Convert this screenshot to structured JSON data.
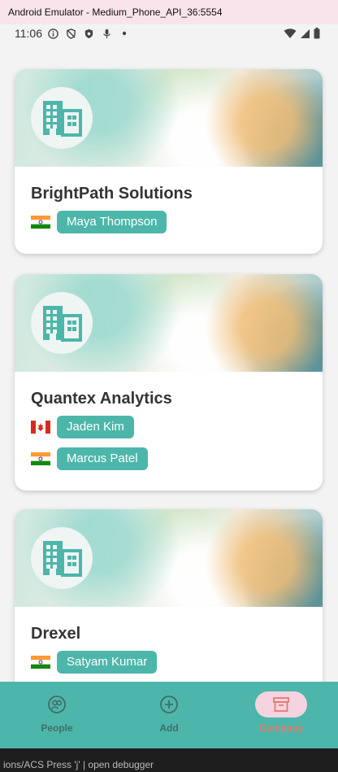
{
  "window": {
    "title": "Android Emulator - Medium_Phone_API_36:5554"
  },
  "statusbar": {
    "time": "11:06"
  },
  "companies": [
    {
      "name": "BrightPath Solutions",
      "people": [
        {
          "flag": "india",
          "name": "Maya Thompson"
        }
      ]
    },
    {
      "name": "Quantex Analytics",
      "people": [
        {
          "flag": "canada",
          "name": "Jaden Kim"
        },
        {
          "flag": "india",
          "name": "Marcus Patel"
        }
      ]
    },
    {
      "name": "Drexel",
      "people": [
        {
          "flag": "india",
          "name": "Satyam Kumar"
        }
      ]
    }
  ],
  "nav": {
    "items": [
      {
        "label": "People",
        "icon": "people-icon"
      },
      {
        "label": "Add",
        "icon": "add-circle-icon"
      },
      {
        "label": "Company",
        "icon": "archive-icon",
        "active": true
      }
    ]
  },
  "colors": {
    "accent": "#4db6aa",
    "nav_active_pill": "#f5d3e1",
    "nav_active_label": "#e57a6e"
  },
  "terminal_strip": {
    "text": "ions/ACS       Press 'j' | open debugger"
  }
}
